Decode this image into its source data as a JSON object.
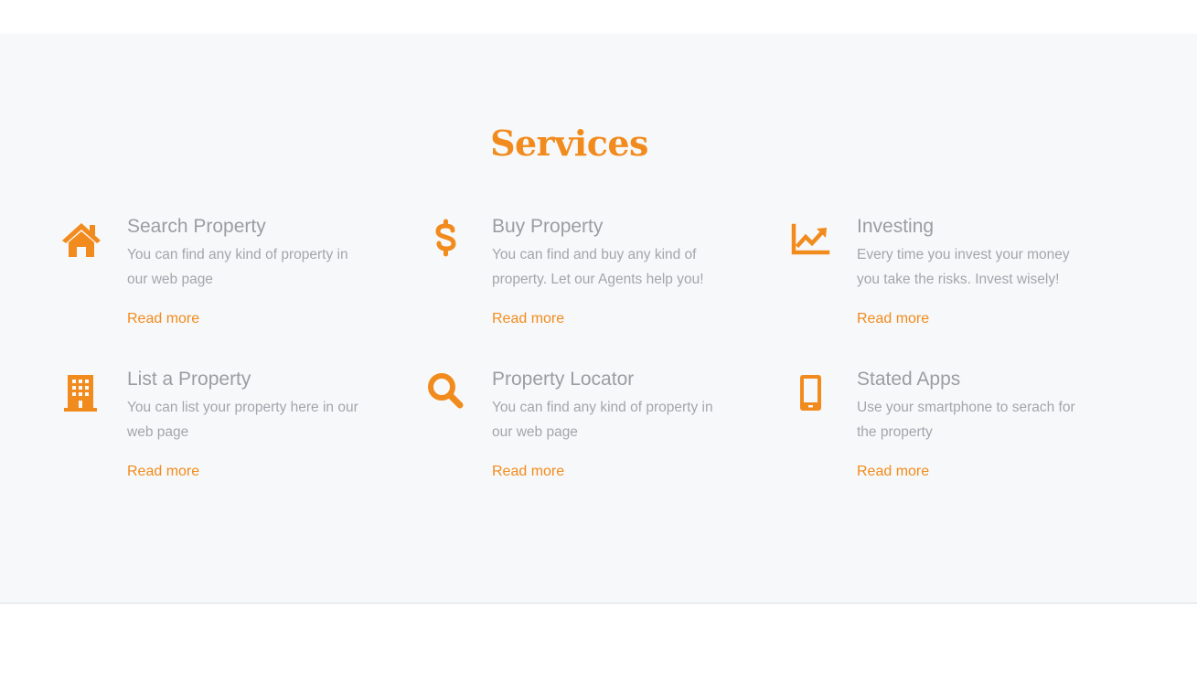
{
  "section": {
    "title": "Services"
  },
  "services": [
    {
      "icon": "house-icon",
      "title": "Search Property",
      "desc": "You can find any kind of property in our web page",
      "link": "Read more"
    },
    {
      "icon": "dollar-icon",
      "title": "Buy Property",
      "desc": "You can find and buy any kind of property. Let our Agents help you!",
      "link": "Read more"
    },
    {
      "icon": "trending-up-icon",
      "title": "Investing",
      "desc": "Every time you invest your money you take the risks. Invest wisely!",
      "link": "Read more"
    },
    {
      "icon": "building-icon",
      "title": "List a Property",
      "desc": "You can list your property here in our web page",
      "link": "Read more"
    },
    {
      "icon": "search-icon",
      "title": "Property Locator",
      "desc": "You can find any kind of property in our web page",
      "link": "Read more"
    },
    {
      "icon": "smartphone-icon",
      "title": "Stated Apps",
      "desc": "Use your smartphone to serach for the property",
      "link": "Read more"
    }
  ],
  "colors": {
    "accent": "#f28b1d",
    "section_background": "#f7f8f9",
    "title_text": "#9a9ea3",
    "body_text": "#a2a6ab"
  }
}
